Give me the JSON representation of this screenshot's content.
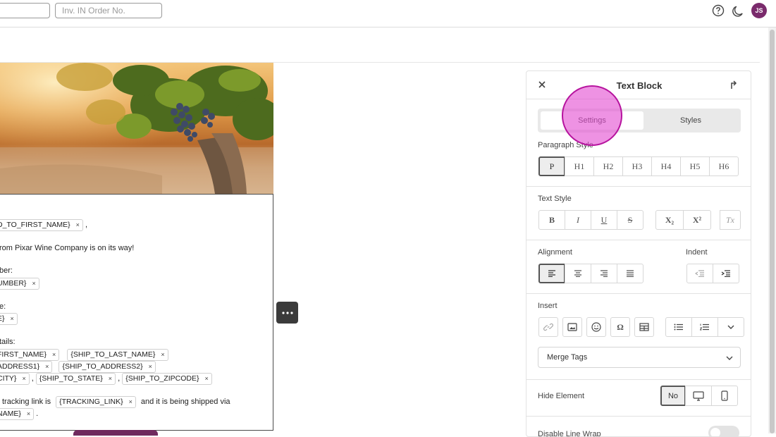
{
  "topbar": {
    "input1_value": "",
    "input2_placeholder": "Inv. IN Order No.",
    "avatar_initials": "JS"
  },
  "email": {
    "lines": [
      {
        "text": "D_TO_FIRST_NAME}",
        "chip": true,
        "suffix": ","
      },
      {
        "text": "rom Pixar Wine Company is on its way!"
      },
      {
        "text": "ber:"
      },
      {
        "text": "UMBER}",
        "chip": true
      },
      {
        "text": "e:"
      },
      {
        "text": "E}",
        "chip": true
      },
      {
        "text": "tails:"
      }
    ],
    "ship_row1": [
      "FIRST_NAME}",
      "{SHIP_TO_LAST_NAME}"
    ],
    "ship_row2": [
      "ADDRESS1}",
      "{SHIP_TO_ADDRESS2}"
    ],
    "ship_row3": [
      "CITY}",
      "{SHIP_TO_STATE}",
      "{SHIP_TO_ZIPCODE}"
    ],
    "tracking_prefix": "tracking link is",
    "tracking_chip": "{TRACKING_LINK}",
    "tracking_suffix": "and it is being shipped via",
    "last_chip": "NAME}",
    "last_suffix": ".",
    "sep_comma": ",",
    "chip_close": "×"
  },
  "panel": {
    "title": "Text Block",
    "tabs": [
      "Settings",
      "Styles"
    ],
    "active_tab": "Settings",
    "paragraph_style_label": "Paragraph Style",
    "paragraph_styles": [
      "P",
      "H1",
      "H2",
      "H3",
      "H4",
      "H5",
      "H6"
    ],
    "text_style_label": "Text Style",
    "text_styles": [
      "B",
      "I",
      "U",
      "S",
      "X₂",
      "X²",
      "Tx"
    ],
    "alignment_label": "Alignment",
    "indent_label": "Indent",
    "insert_label": "Insert",
    "merge_tags_label": "Merge Tags",
    "hide_element_label": "Hide Element",
    "hide_element_no": "No",
    "disable_line_wrap_label": "Disable Line Wrap"
  },
  "colors": {
    "avatar": "#7a2b6c",
    "click_indicator": "#e24ad1",
    "dots_button": "#3b3b3b"
  }
}
